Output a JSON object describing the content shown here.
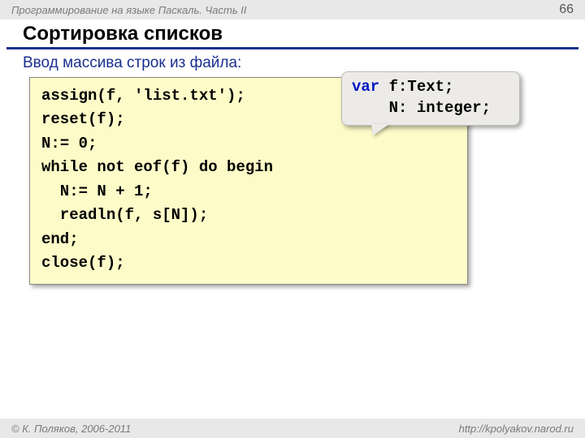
{
  "header": {
    "course": "Программирование на языке Паскаль. Часть II",
    "page": "66"
  },
  "title": "Сортировка списков",
  "subtitle": "Ввод массива строк из файла:",
  "code": {
    "l1": "assign(f, 'list.txt');",
    "l2": "reset(f);",
    "l3": "N:= 0;",
    "l4": "while not eof(f) do begin",
    "l5": "  N:= N + 1;",
    "l6": "  readln(f, s[N]);",
    "l7": "end;",
    "l8": "close(f);"
  },
  "callout": {
    "kw_var": "var",
    "line1_rest": " f:Text;",
    "line2": "    N: integer;"
  },
  "footer": {
    "copyright": "© К. Поляков, 2006-2011",
    "url": "http://kpolyakov.narod.ru"
  }
}
